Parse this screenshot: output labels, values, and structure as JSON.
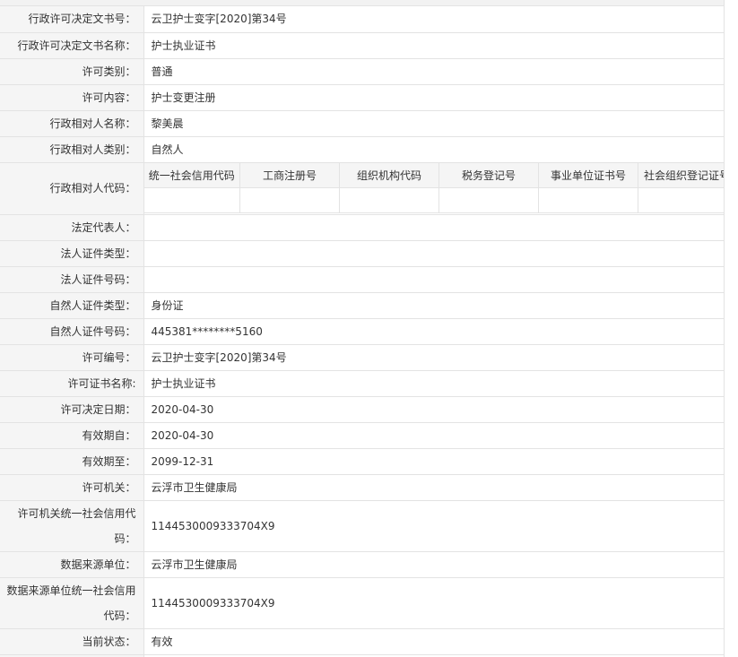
{
  "rows": [
    {
      "label": "行政许可决定文书号：",
      "value": "云卫护士变字[2020]第34号"
    },
    {
      "label": "行政许可决定文书名称：",
      "value": "护士执业证书"
    },
    {
      "label": "许可类别：",
      "value": "普通"
    },
    {
      "label": "许可内容：",
      "value": "护士变更注册"
    },
    {
      "label": "行政相对人名称：",
      "value": "黎美晨"
    },
    {
      "label": "行政相对人类别：",
      "value": "自然人"
    }
  ],
  "code_row": {
    "label": "行政相对人代码：",
    "headers": [
      "统一社会信用代码",
      "工商注册号",
      "组织机构代码",
      "税务登记号",
      "事业单位证书号",
      "社会组织登记证号"
    ]
  },
  "rows2": [
    {
      "label": "法定代表人：",
      "value": ""
    },
    {
      "label": "法人证件类型：",
      "value": ""
    },
    {
      "label": "法人证件号码：",
      "value": ""
    },
    {
      "label": "自然人证件类型：",
      "value": "身份证"
    },
    {
      "label": "自然人证件号码：",
      "value": "445381********5160"
    },
    {
      "label": "许可编号：",
      "value": "云卫护士变字[2020]第34号"
    },
    {
      "label": "许可证书名称:",
      "value": "护士执业证书"
    },
    {
      "label": "许可决定日期：",
      "value": "2020-04-30"
    },
    {
      "label": "有效期自：",
      "value": "2020-04-30"
    },
    {
      "label": "有效期至：",
      "value": "2099-12-31"
    },
    {
      "label": "许可机关：",
      "value": "云浮市卫生健康局"
    }
  ],
  "org_code": {
    "label": "许可机关统一社会信用代码：",
    "value": "1144530009333704X9"
  },
  "source_unit": {
    "label": "数据来源单位：",
    "value": "云浮市卫生健康局"
  },
  "source_code": {
    "label": "数据来源单位统一社会信用代码：",
    "value": "1144530009333704X9"
  },
  "status": {
    "label": "当前状态：",
    "value": "有效"
  }
}
